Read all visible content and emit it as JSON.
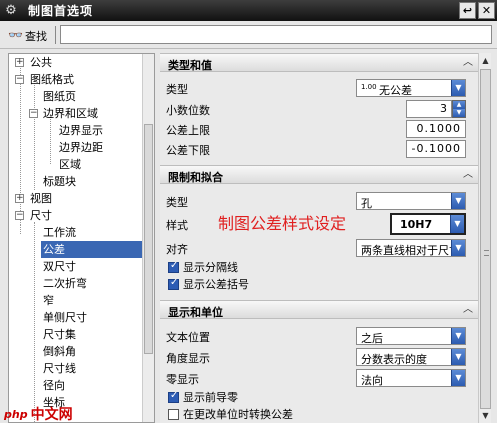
{
  "window": {
    "title": "制图首选项",
    "btn_restore": "↩",
    "btn_close": "✕"
  },
  "search": {
    "label": "查找",
    "value": ""
  },
  "tree": {
    "items": [
      {
        "label": "公共",
        "expander": "+"
      },
      {
        "label": "图纸格式",
        "expander": "−"
      },
      {
        "label": "图纸页"
      },
      {
        "label": "边界和区域",
        "expander": "−"
      },
      {
        "label": "边界显示"
      },
      {
        "label": "边界边距"
      },
      {
        "label": "区域"
      },
      {
        "label": "标题块"
      },
      {
        "label": "视图",
        "expander": "+"
      },
      {
        "label": "尺寸",
        "expander": "−"
      },
      {
        "label": "工作流"
      },
      {
        "label": "公差",
        "selected": true
      },
      {
        "label": "双尺寸"
      },
      {
        "label": "二次折弯"
      },
      {
        "label": "窄"
      },
      {
        "label": "单侧尺寸"
      },
      {
        "label": "尺寸集"
      },
      {
        "label": "倒斜角"
      },
      {
        "label": "尺寸线"
      },
      {
        "label": "径向"
      },
      {
        "label": "坐标"
      }
    ]
  },
  "sections": {
    "type_value": {
      "title": "类型和值",
      "type_label": "类型",
      "type_value": "无公差",
      "type_value_prefix": "1.00",
      "decimals_label": "小数位数",
      "decimals_value": "3",
      "upper_label": "公差上限",
      "upper_value": "0.1000",
      "lower_label": "公差下限",
      "lower_value": "-0.1000"
    },
    "limits_fits": {
      "title": "限制和拟合",
      "type_label": "类型",
      "type_value": "孔",
      "style_label": "样式",
      "style_value": "10H7",
      "align_label": "对齐",
      "align_value": "两条直线相对于尺寸",
      "show_separator_label": "显示分隔线",
      "show_separator": true,
      "show_brackets_label": "显示公差括号",
      "show_brackets": true
    },
    "display_units": {
      "title": "显示和单位",
      "text_pos_label": "文本位置",
      "text_pos_value": "之后",
      "angle_label": "角度显示",
      "angle_value": "分数表示的度",
      "zero_label": "零显示",
      "zero_value": "法向",
      "leading_zero_label": "显示前导零",
      "leading_zero": true,
      "convert_label": "在更改单位时转换公差",
      "convert": false
    }
  },
  "annotation": {
    "text": "制图公差样式设定",
    "color": "#e01f1f"
  },
  "watermark": {
    "logo": "php",
    "text": "中文网"
  },
  "colors": {
    "selection": "#3a67b3",
    "dropdown_button": "#2c5bb0",
    "titlebar": "#1a1a1a"
  }
}
